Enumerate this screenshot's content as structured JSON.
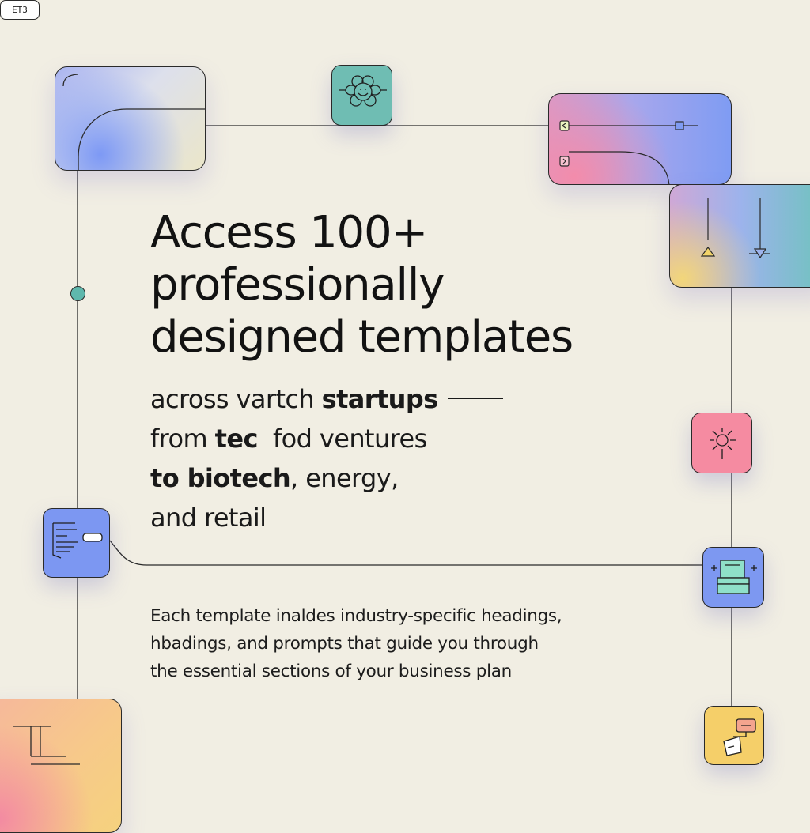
{
  "headline": {
    "line1": "Access 100+",
    "line2": "professionally",
    "line3": "designed templates"
  },
  "subhead": {
    "l1_regular": "across vartch ",
    "l1_bold": "startups",
    "l2_regular_a": "from ",
    "l2_bold": "tec",
    "l2_regular_b": "  fod ventures",
    "l3_bold": "to biotech",
    "l3_regular": ", energy,",
    "l4_regular": "and retail"
  },
  "body": {
    "line1": "Each template inaldes industry-specific headings,",
    "line2": "hbadings, and prompts that guide you through",
    "line3": "the essential sections of your business plan"
  },
  "badge": {
    "code": "ET3"
  },
  "icons": {
    "tile_1": "flower-icon",
    "tile_2": "document-icon",
    "tile_3": "spark-icon",
    "tile_4": "machine-icon",
    "tile_5": "price-tag-icon"
  },
  "colors": {
    "background": "#f1eee3",
    "teal": "#6fbdb3",
    "periwinkle": "#7c97f2",
    "pink": "#f58ba1",
    "yellow": "#f5cf69",
    "ink": "#141414"
  }
}
